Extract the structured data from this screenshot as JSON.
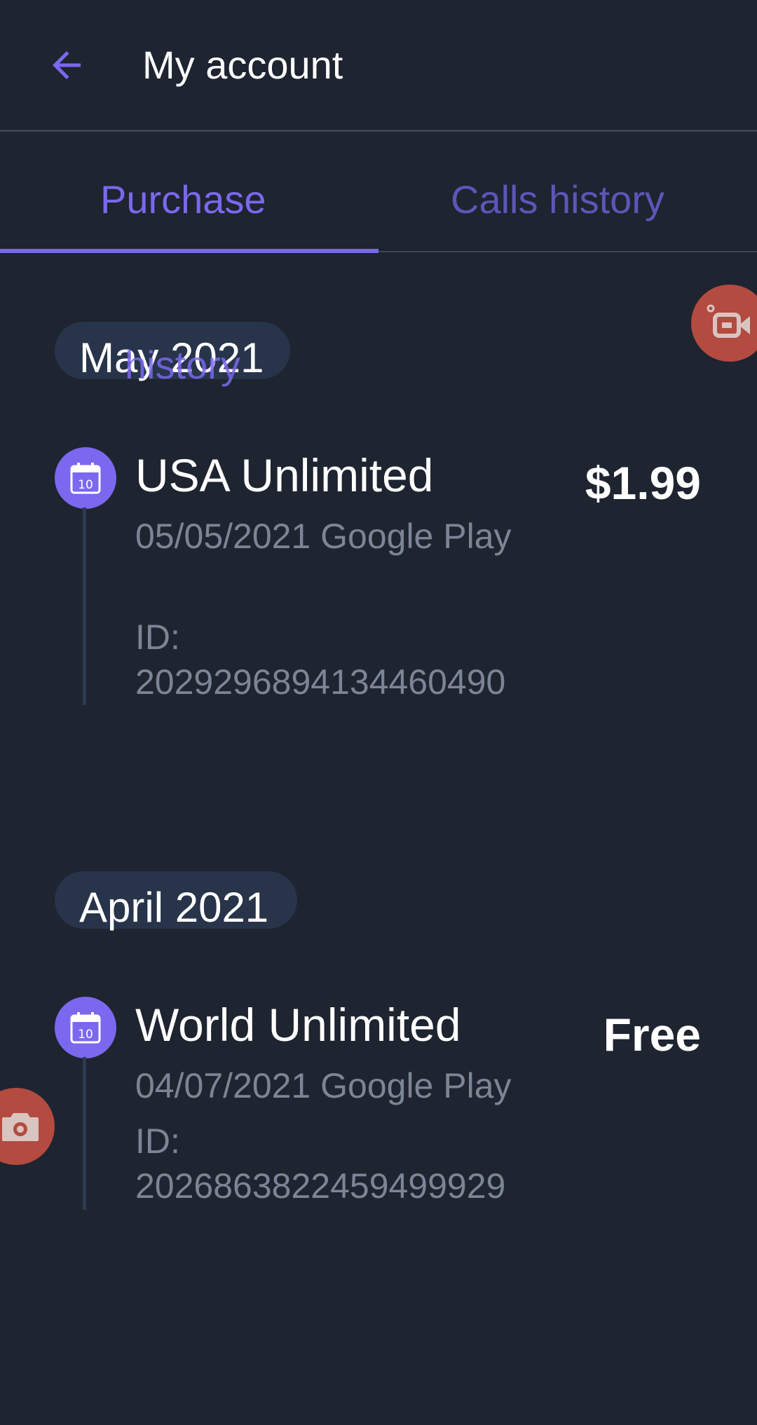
{
  "header": {
    "title": "My account"
  },
  "tabs": [
    {
      "label": "Purchase"
    },
    {
      "label": "Calls history"
    }
  ],
  "overlay_text": "history",
  "groups": [
    {
      "month": "May 2021",
      "item": {
        "name": "USA Unlimited",
        "date_store": "05/05/2021 Google Play",
        "id_label": "ID:",
        "id_value": "2029296894134460490",
        "price": "$1.99",
        "calendar_day": "10"
      }
    },
    {
      "month": "April 2021",
      "item": {
        "name": "World Unlimited",
        "date_store": "04/07/2021 Google Play",
        "id_label": "ID:",
        "id_value": "2026863822459499929",
        "price": "Free",
        "calendar_day": "10"
      }
    }
  ],
  "colors": {
    "background": "#1e2430",
    "accent": "#7b68ee",
    "fab": "#b34b40",
    "secondary_text": "#7b8595"
  }
}
